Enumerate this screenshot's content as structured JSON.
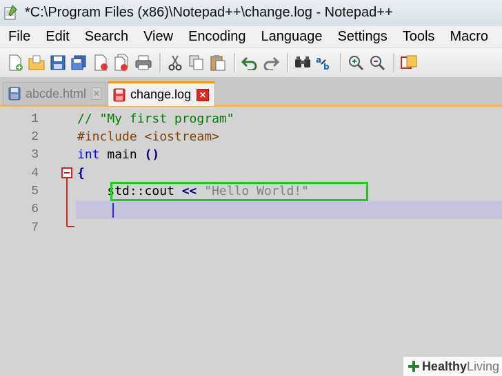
{
  "window": {
    "title": "*C:\\Program Files (x86)\\Notepad++\\change.log - Notepad++"
  },
  "menu": [
    {
      "label": "File"
    },
    {
      "label": "Edit"
    },
    {
      "label": "Search"
    },
    {
      "label": "View"
    },
    {
      "label": "Encoding"
    },
    {
      "label": "Language"
    },
    {
      "label": "Settings"
    },
    {
      "label": "Tools"
    },
    {
      "label": "Macro"
    }
  ],
  "toolbar": {
    "icons": [
      "new-file-icon",
      "open-file-icon",
      "save-icon",
      "save-all-icon",
      "close-icon",
      "close-all-icon",
      "print-icon",
      "cut-icon",
      "copy-icon",
      "paste-icon",
      "undo-icon",
      "redo-icon",
      "find-icon",
      "replace-icon",
      "zoom-in-icon",
      "zoom-out-icon",
      "sync-icon"
    ]
  },
  "tabs": [
    {
      "label": "abcde.html",
      "active": false
    },
    {
      "label": "change.log",
      "active": true
    }
  ],
  "editor": {
    "line_numbers": [
      "1",
      "2",
      "3",
      "4",
      "5",
      "6",
      "7"
    ],
    "lines": [
      [
        {
          "t": "comment",
          "v": "// \"My first program\""
        }
      ],
      [
        {
          "t": "pre",
          "v": "#include <iostream>"
        }
      ],
      [
        {
          "t": "kw",
          "v": "int"
        },
        {
          "t": "plain",
          "v": " main "
        },
        {
          "t": "op",
          "v": "()"
        }
      ],
      [
        {
          "t": "op",
          "v": "{"
        }
      ],
      [
        {
          "t": "plain",
          "v": "    std::cout "
        },
        {
          "t": "op",
          "v": "<<"
        },
        {
          "t": "plain",
          "v": " "
        },
        {
          "t": "str",
          "v": "\"Hello World!\""
        }
      ],
      [],
      []
    ]
  },
  "watermark": {
    "bold": "Healthy",
    "light": " Living"
  },
  "colors": {
    "accent_tab": "#f39c12",
    "highlight_box": "#18d018",
    "current_line": "#c5c4dc"
  }
}
